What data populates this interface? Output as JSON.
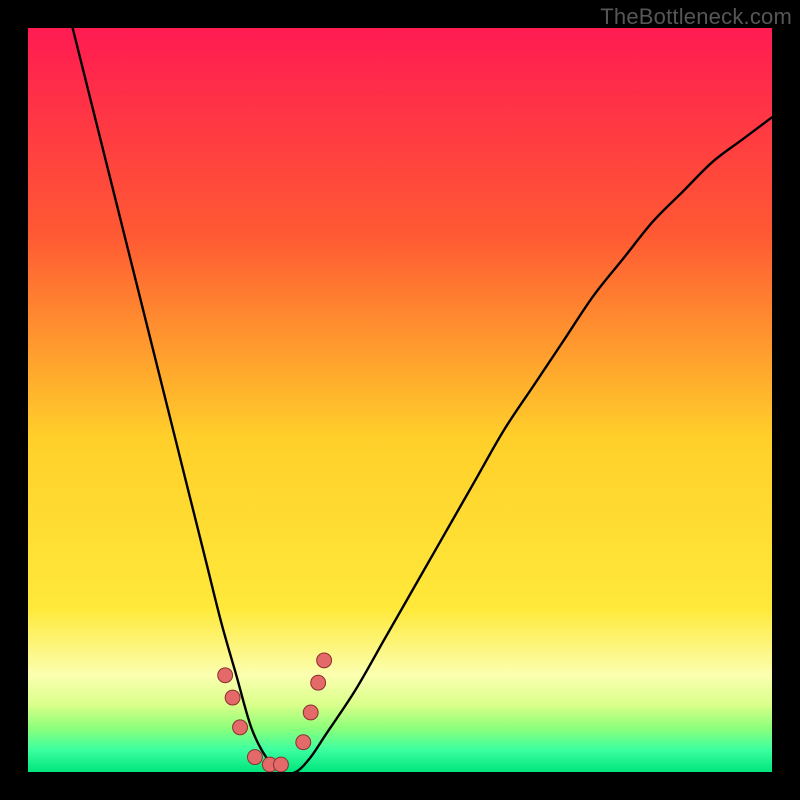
{
  "watermark": "TheBottleneck.com",
  "colors": {
    "frame": "#000000",
    "gradient_top": "#ff1b52",
    "gradient_mid1": "#ff7a2a",
    "gradient_mid2": "#ffe22a",
    "gradient_band_light": "#fbffb0",
    "gradient_band_green1": "#9fff7a",
    "gradient_band_green2": "#2bff8d",
    "gradient_bottom": "#00e57d",
    "curve": "#000000",
    "dot_fill": "#e46a6a",
    "dot_stroke": "#8a2f2f"
  },
  "chart_data": {
    "type": "line",
    "title": "",
    "xlabel": "",
    "ylabel": "",
    "xlim": [
      0,
      100
    ],
    "ylim": [
      0,
      100
    ],
    "notes": "Bottleneck-style valley curve. y is approximate bottleneck percentage (high=bad/red, low=good/green). Curve reaches ~0 near x≈30–36 then rises toward the right edge.",
    "series": [
      {
        "name": "bottleneck-curve",
        "x": [
          6,
          8,
          10,
          12,
          14,
          16,
          18,
          20,
          22,
          24,
          26,
          28,
          30,
          32,
          34,
          36,
          38,
          40,
          44,
          48,
          52,
          56,
          60,
          64,
          68,
          72,
          76,
          80,
          84,
          88,
          92,
          96,
          100
        ],
        "y": [
          100,
          92,
          84,
          76,
          68,
          60,
          52,
          44,
          36,
          28,
          20,
          13,
          6,
          2,
          0,
          0,
          2,
          5,
          11,
          18,
          25,
          32,
          39,
          46,
          52,
          58,
          64,
          69,
          74,
          78,
          82,
          85,
          88
        ]
      }
    ],
    "dots": [
      {
        "x": 26.5,
        "y": 13
      },
      {
        "x": 27.5,
        "y": 10
      },
      {
        "x": 28.5,
        "y": 6
      },
      {
        "x": 30.5,
        "y": 2
      },
      {
        "x": 32.5,
        "y": 1
      },
      {
        "x": 34.0,
        "y": 1
      },
      {
        "x": 37.0,
        "y": 4
      },
      {
        "x": 38.0,
        "y": 8
      },
      {
        "x": 39.0,
        "y": 12
      },
      {
        "x": 39.8,
        "y": 15
      }
    ],
    "dot_radius_pct": 1.0
  }
}
